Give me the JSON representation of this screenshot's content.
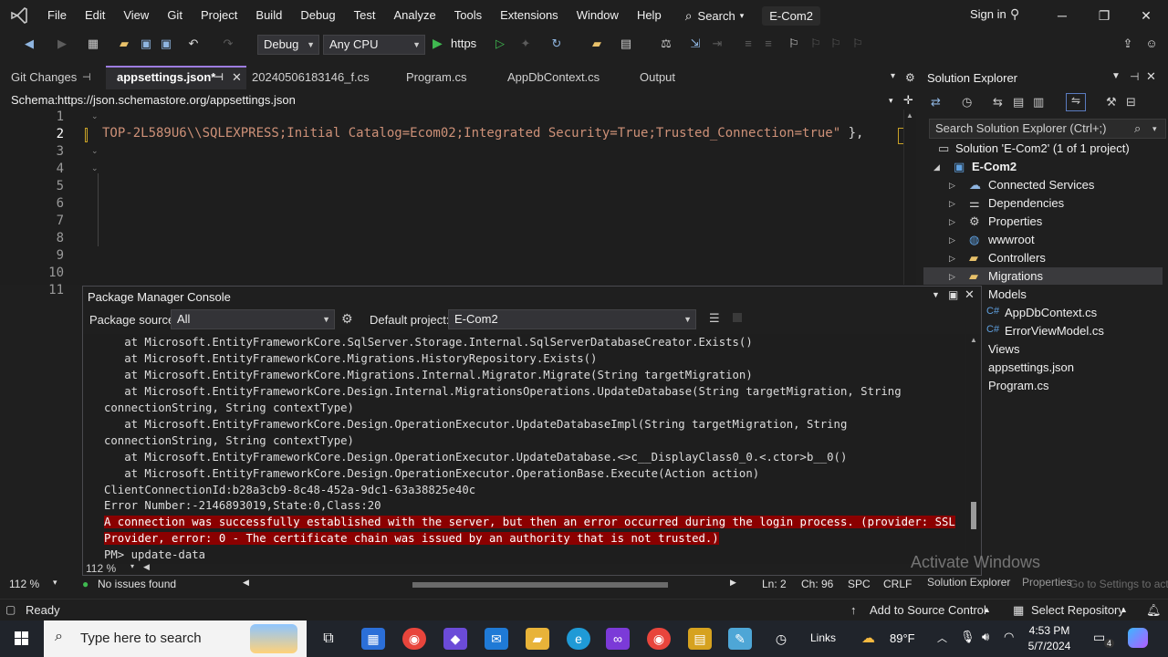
{
  "title_bar": {
    "menu": [
      "File",
      "Edit",
      "View",
      "Git",
      "Project",
      "Build",
      "Debug",
      "Test",
      "Analyze",
      "Tools",
      "Extensions",
      "Window",
      "Help"
    ],
    "search_label": "Search",
    "solution_name": "E-Com2",
    "sign_in": "Sign in"
  },
  "toolbar": {
    "config": "Debug",
    "platform": "Any CPU",
    "run_target": "https"
  },
  "doc_tabs": {
    "git_changes": "Git Changes",
    "tabs": [
      "appsettings.json*",
      "20240506183146_f.cs",
      "Program.cs",
      "AppDbContext.cs",
      "Output"
    ]
  },
  "schema": {
    "label": "Schema:",
    "url": "https://json.schemastore.org/appsettings.json"
  },
  "editor": {
    "line_numbers": [
      "1",
      "2",
      "3",
      "4",
      "5",
      "6",
      "7",
      "8",
      "9",
      "10",
      "11"
    ],
    "current_line": "2",
    "code_string": "TOP-2L589U6\\\\SQLEXPRESS;Initial Catalog=Ecom02;Integrated Security=True;Trusted_Connection=true\"",
    "code_tail": " },"
  },
  "solution_explorer": {
    "title": "Solution Explorer",
    "search_placeholder": "Search Solution Explorer (Ctrl+;)",
    "solution": "Solution 'E-Com2' (1 of 1 project)",
    "project": "E-Com2",
    "items": [
      "Connected Services",
      "Dependencies",
      "Properties",
      "wwwroot",
      "Controllers",
      "Migrations",
      "Models",
      "AppDbContext.cs",
      "ErrorViewModel.cs",
      "Views",
      "appsettings.json",
      "Program.cs"
    ]
  },
  "pmc": {
    "title": "Package Manager Console",
    "source_label": "Package source:",
    "source_value": "All",
    "project_label": "Default project:",
    "project_value": "E-Com2",
    "lines": [
      "   at Microsoft.EntityFrameworkCore.SqlServer.Storage.Internal.SqlServerDatabaseCreator.Exists()",
      "   at Microsoft.EntityFrameworkCore.Migrations.HistoryRepository.Exists()",
      "   at Microsoft.EntityFrameworkCore.Migrations.Internal.Migrator.Migrate(String targetMigration)",
      "   at Microsoft.EntityFrameworkCore.Design.Internal.MigrationsOperations.UpdateDatabase(String targetMigration, String",
      "connectionString, String contextType)",
      "   at Microsoft.EntityFrameworkCore.Design.OperationExecutor.UpdateDatabaseImpl(String targetMigration, String",
      "connectionString, String contextType)",
      "   at Microsoft.EntityFrameworkCore.Design.OperationExecutor.UpdateDatabase.<>c__DisplayClass0_0.<.ctor>b__0()",
      "   at Microsoft.EntityFrameworkCore.Design.OperationExecutor.OperationBase.Execute(Action action)",
      "ClientConnectionId:b28a3cb9-8c48-452a-9dc1-63a38825e40c",
      "Error Number:-2146893019,State:0,Class:20"
    ],
    "error_lines": [
      "A connection was successfully established with the server, but then an error occurred during the login process. (provider: SSL",
      "Provider, error: 0 - The certificate chain was issued by an authority that is not trusted.)"
    ],
    "prompt": "PM> update-data",
    "zoom": "112 %"
  },
  "editor_status": {
    "zoom": "112 %",
    "issues": "No issues found",
    "ln": "Ln: 2",
    "ch": "Ch: 96",
    "spc": "SPC",
    "crlf": "CRLF"
  },
  "watermark": {
    "line1": "Activate Windows",
    "line2": "Go to Settings to activate Windows.",
    "tab_overlay": "Solution Explorer",
    "tab_overlay2": "Properties"
  },
  "status_bar": {
    "ready": "Ready",
    "add_source": "Add to Source Control",
    "select_repo": "Select Repository",
    "bell_count": ""
  },
  "taskbar": {
    "search_placeholder": "Type here to search",
    "links": "Links",
    "weather": "89°F",
    "time": "4:53 PM",
    "date": "5/7/2024",
    "notif_count": "4"
  }
}
